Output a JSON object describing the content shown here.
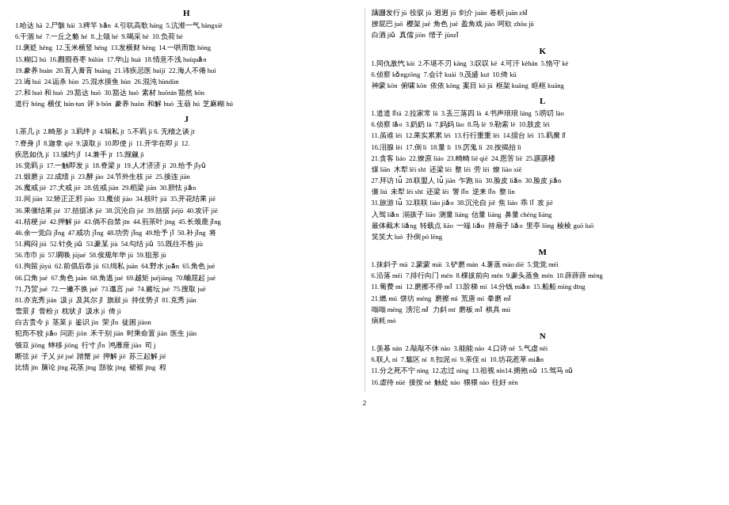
{
  "page": {
    "number": "2",
    "left_column": {
      "sections": [
        {
          "header": "H",
          "entries": [
            "1.哈达 hā  2.尸骸 hái  3.稗竿 hǎn  4.引吭高歌 háng  5.沆瀣一气 hàngxiè",
            "6.干涸 hé  7.一丘之貉 hé  8.上颌 hé  9.喝采 hè  10.负荷 hè",
            "11.褒贬 héng  12.玉米横竖 héng  13.发横财 hèng  14.一哄而散 hòng",
            "15.糊口 hú  16.囫囵吞枣 húlún  17.华山 huà  18.情意不浅 huíquǎn",
            "19.豢养 huàn  20.肓入膏肓 huāng  21.讳疾忌医 huìjí  22.海人不倦 huì",
            "23.诲 huì  24.诟杀 hùn  25.混水摸鱼 hùn  26.混沌 hùndùn",
            "27.和 huó 和 huò  29.豁达 huō  30.豁达 huò  素材 huōrán 豁然 hōn",
            "道行 hóng  横仗 hún·tun  评 h·bōn  豢养 huòn  和解 huò  玉葫 hú  芝麻糊 hú"
          ]
        },
        {
          "header": "J",
          "entries": [
            "1.茶几 jī  2.畸形 jī  3.羁绊 jī  4.辑私 jī  5.不羁 jì 6. 无稽之谈 jī",
            "7.脊身 jǐ  8.迦拿 qiē  9.汲取 jí  10.即使 jí  11.开学在即 jí  12.",
            "疾恶如仇 jí  13.缄约 jǐ  14.兼手 jī  15.觊觎 jì",
            "16.觉羁 jì  17.一触即发 jì  18.脊梁 jī  19.人才济济 jì  20.给予 jǐyǔ",
            "21.煅磨 jì  22.成绩 jì  23.酵 jào  24.节外生枝 jiē  25.接连 jiān",
            "26.魔戒 jiè  27.犬戒 jiè  28.佐戒 jiān  29.稻梁 jiān  30.胆怯 jiǎn",
            "31.间 jiān  32.矫正正邪 jiào  33.魔侦 jiào  34.枝叶 jiā  35.开花结果 jiē",
            "36.果僵结果 jié  37.拮据冰 jiè  38.沉沦自 jié  39.拮据 jiéjū  40.攻讦 jiē",
            "41.桔梗 jié  42.押解 jiè  43.倘不自禁 jīn  44.煎茶叶 jīng  45.长颈鹿 jǐng",
            "46.余一觉白 jǐng  47.戒功 jǐng  48.功劳 jǐng  49.给予 jǐ  50.补 jǐng  将",
            "51.阀闷 jiū  52.针灸 jiǔ  53.豪某 jiù  54.勾结 jiǔ  55.既往不咎 jiù",
            "56.市巾 jū  57.啁唤 jūjué  58.俟规年华 jū  59.狙形 jū",
            "61.拘留 jūyú  62.前倡后恭 jū  63.缉私 juān  64.野水 juǎn  65.角色 jué",
            "66.口角 jué  67.角色 juān  68.角逃 jué  69.越矩 juéjiàng  70.蛐屈起 jué",
            "71.乃贸 juē  72.一撇不换 juē  73.谶言 juè  74.赌坛 juè  75.搜取 juē",
            "81.亦克秀 jiān  汲 jí  及其尔 jǐ  旗鼓 jū  持仗势 jǐ  81. 克秀 jiān",
            "雪景 jǐ  骨粉 jī  枕状 jǐ  汲水 jí  倚 jì",
            "白古贵今 jì  茎菜 jì  鉴识 jìn  荣 jǐn  徒困 jiàon",
            "犯而不狡 jiǎo  问距 jiōn  禾干别 jiān  时乘命置 jiān  医生 jiān",
            "顿豆 jiōng  蟀移 jiōng  行寸 jǐn  鸿雁座 jiào  司 j",
            "断弦 jiē  子乂 jiē jué  踏蟹 jiē  押解 jiē  苏三起解 jiē",
            "比情 jīn  脑论 jīng 花茎 jīng  顗妆 jīng  裙裾 jīng  程"
          ]
        }
      ]
    },
    "right_column": {
      "sections": [
        {
          "header": "",
          "entries": [
            "蹒跚发行 jū  役驭 jū  迥迥 jū  剑介 juān  卷积 juān zhǐ",
            "撩屁巴 juō  樱架 juē  角色 juē  盈角戏 jiào  呵欸 zhōu jū",
            "白酒 jiǔ  真儒 jiōn  缙子 jūnzǐ"
          ]
        },
        {
          "header": "K",
          "entries": [
            "1.同仇敌忾 kài  2.不堪不刃 kāng  3.叹叹 kē  4.可汗 kèhán  5.恪守 kè",
            "6.侦察 kǒngzōng  7.会计 kuài  9.茂盛 kuī  10.倚 kū",
            "神蒙 kōn  俯啸 kōn  依依 kōng  案目 kō jū  框架 kuāng  眶框 kuāng"
          ]
        },
        {
          "header": "L",
          "entries": [
            "1.道道 lǐtā  2.拉家常 lā  3.丢三落四 là  4.书声琅琅 láng  5.唠叨 lào",
            "6.侦察 lǎo  3.奶奶 là  7.妈妈 lào  8.鸟 lè  9.勒索 lè  10.肢皮 léi",
            "11.虽谁 léi  12.果实累累 léi  13.行行重重 lèi  14.擂台 léi  15.羁縻 lǐ",
            "16.泪腺 lèi  17.倒 lì  18.量 lì  19.厉鬼 lì  20.按揭抬 lì",
            "21.贪客 liáo  22.燎原 liáo  23.畸畸 liē qiē  24.恩苦 liē  25.蹊蹊楼",
            "煤 liān  木犁 lēi shī  还梁 lēi  整 lēi  劳 lēi  燎 liào xiē",
            "27.拜访 lǚ  28.联盟人 lǚ jiān  乍跑 liù  30.脸皮 liǎn  30.脸皮 jiǎn",
            "僵 liú  未犁 lèi shī  还梁 lèi  警 lǐn  逆来 lǐn  整 lín",
            "31.旅游 lǚ  32.联联 liáo jiǎo  38.沉沦自 jiě  焦 liáo  乖 lǐ  攻 jiē",
            "入驾 liǎn  溺孩子 liāo  测量 liáng  估量 liáng  鼻量 chéng liáng",
            "最体截木 liǎng  转载点 liāo  一端 liǎo  持扇子 liǎo  里亭 lōng  棱棱 guō luō",
            "笑笑大 luó  扑倒 pō lēng"
          ]
        },
        {
          "header": "M",
          "entries": [
            "1.抹斜子 mā  2.蒙蒙 mái  3.铲磨 mán  4.薯蒸 mào diē  5.觉觉 méi",
            "6.沿落 mēi  7.排行向门 mén  8.棵拔前向 mén  9.豪头蒸鱼 mén  10.薛薛薛 mèng",
            "11.葡费 mi  12.磨擦不停 mǐ  13.阶梯 mí  14.分钱 miǎn  15.船船 míng dīng",
            "21.燃 mú  饼坊 méng  磨擦 mì  荒唐 mí  拳磨 mǐ",
            "嗡嗡 mēng  滂沱 mǐ  力斜 mī  磨板 mǐ  棋具 mú",
            "病耗 mó"
          ]
        },
        {
          "header": "N",
          "entries": [
            "1.羡慕 nán  2.敲敲不休 nào  3.能能 nāo  4.口诗 né  5.气虚 nèi",
            "6.联人 ní  7.魃区 ní  8.扣泥 ní  9.亲侄 ní  10.坊花惹草 miǎn",
            "11.分之死不宁 nìng  12.志过 níng  13.祖视 nín14.拥抱 nǔ  15.驾马 nǔ",
            "16.虐待 nüè  接按 nè  触处 nào  猥猥 nào  往好 nèn"
          ]
        }
      ]
    }
  }
}
